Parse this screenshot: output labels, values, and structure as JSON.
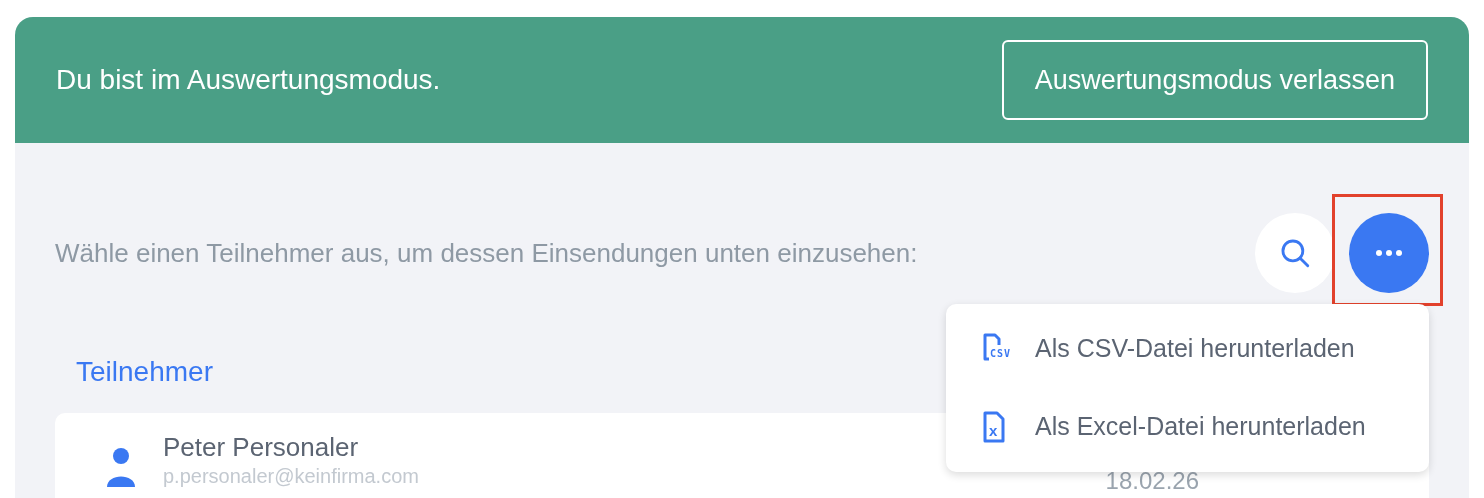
{
  "banner": {
    "message": "Du bist im Auswertungsmodus.",
    "exit_button": "Auswertungsmodus verlassen"
  },
  "prompt": "Wähle einen Teilnehmer aus, um dessen Einsendungen unten einzusehen:",
  "more_button": {
    "highlighted": true
  },
  "menu": [
    {
      "kind": "csv",
      "icon_label": "CSV",
      "label": "Als CSV-Datei herunterladen"
    },
    {
      "kind": "excel",
      "icon_label": "x",
      "label": "Als Excel-Datei herunterladen"
    }
  ],
  "section_title": "Teilnehmer",
  "participants": [
    {
      "name": "Peter Personaler",
      "email": "p.personaler@keinfirma.com",
      "date": "18.02.26"
    }
  ]
}
